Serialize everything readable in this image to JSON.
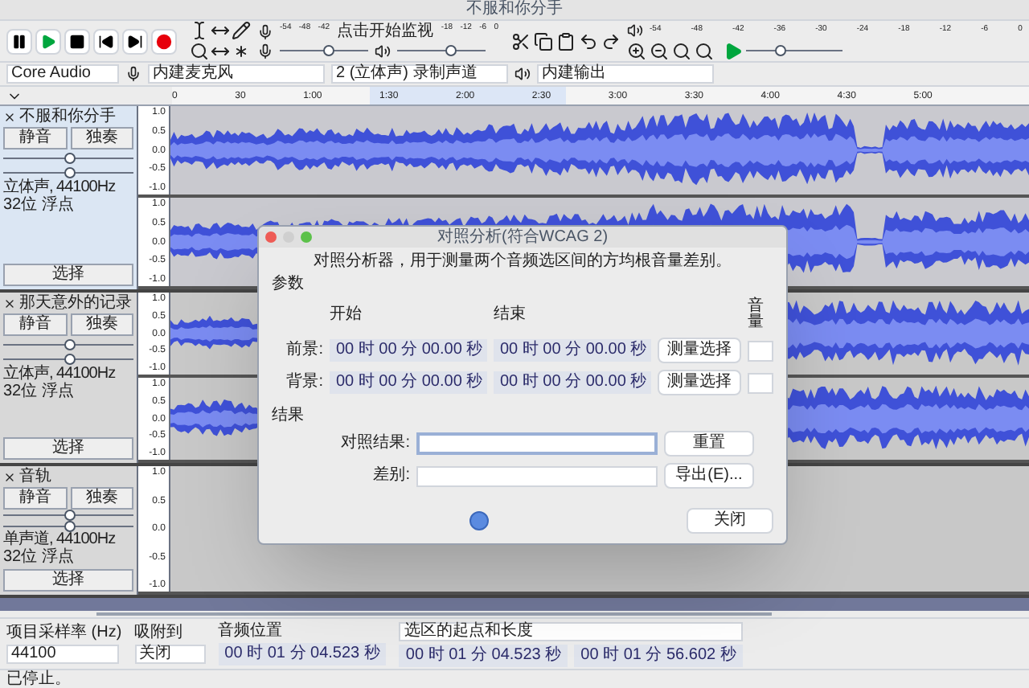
{
  "window": {
    "title": "不服和你分手"
  },
  "record_meter": {
    "ticks": [
      "-54",
      "-48",
      "-42",
      "点击开始监视",
      "-18",
      "-12",
      "-6",
      "0"
    ]
  },
  "playback_meter": {
    "ticks": [
      "-54",
      "-48",
      "-42",
      "-36",
      "-30",
      "-24",
      "-18",
      "-12",
      "-6",
      "0"
    ]
  },
  "record_volume": {
    "level": 0.55
  },
  "playback_volume": {
    "level": 0.6
  },
  "play_speed": {
    "level": 0.35
  },
  "devices": {
    "host": "Core Audio",
    "input": "内建麦克风",
    "channels": "2 (立体声) 录制声道",
    "output": "内建输出"
  },
  "ruler": {
    "ticks": [
      "0",
      "30",
      "1:00",
      "1:30",
      "2:00",
      "2:30",
      "3:00",
      "3:30",
      "4:00",
      "4:30",
      "5:00"
    ]
  },
  "tracks": [
    {
      "name": "不服和你分手",
      "selected": true,
      "mute": "静音",
      "solo": "独奏",
      "gain": {
        "level": 0.5
      },
      "pan": {
        "level": 0.5
      },
      "info": "立体声, 44100Hz",
      "format": "32位 浮点",
      "select": "选择",
      "channels": [
        {
          "has_audio": true,
          "scale": [
            "1.0",
            "0.5",
            "0.0",
            "-0.5",
            "-1.0"
          ]
        },
        {
          "has_audio": true,
          "scale": [
            "1.0",
            "0.5",
            "0.0",
            "-0.5",
            "-1.0"
          ]
        }
      ]
    },
    {
      "name": "那天意外的记录",
      "selected": false,
      "mute": "静音",
      "solo": "独奏",
      "gain": {
        "level": 0.5
      },
      "pan": {
        "level": 0.5
      },
      "info": "立体声, 44100Hz",
      "format": "32位 浮点",
      "select": "选择",
      "channels": [
        {
          "has_audio": true,
          "scale": [
            "1.0",
            "0.5",
            "0.0",
            "-0.5",
            "-1.0"
          ]
        },
        {
          "has_audio": true,
          "scale": [
            "1.0",
            "0.5",
            "0.0",
            "-0.5",
            "-1.0"
          ]
        }
      ]
    },
    {
      "name": "音轨",
      "selected": false,
      "mute": "静音",
      "solo": "独奏",
      "gain": {
        "level": 0.5
      },
      "pan": {
        "level": 0.5
      },
      "info": "单声道, 44100Hz",
      "format": "32位 浮点",
      "select": "选择",
      "channels": [
        {
          "has_audio": false,
          "scale": [
            "1.0",
            "0.5",
            "0.0",
            "-0.5",
            "-1.0"
          ]
        }
      ]
    }
  ],
  "dialog": {
    "title": "对照分析(符合WCAG 2)",
    "description": "对照分析器，用于测量两个音频选区间的方均根音量差别。",
    "params_label": "参数",
    "col_start": "开始",
    "col_end": "结束",
    "col_volume": "音量",
    "rows": [
      {
        "label": "前景:",
        "start": "00 时 00 分 00.00 秒",
        "end": "00 时 00 分 00.00 秒",
        "button": "测量选择"
      },
      {
        "label": "背景:",
        "start": "00 时 00 分 00.00 秒",
        "end": "00 时 00 分 00.00 秒",
        "button": "测量选择"
      }
    ],
    "results_label": "结果",
    "contrast_label": "对照结果:",
    "reset": "重置",
    "diff_label": "差别:",
    "export": "导出(E)...",
    "close": "关闭"
  },
  "selection_bar": {
    "rate_label": "项目采样率 (Hz)",
    "snap_label": "吸附到",
    "position_label": "音频位置",
    "selection_label": "选区的起点和长度",
    "rate": "44100",
    "snap": "关闭",
    "position": "00 时 01 分 04.523 秒",
    "sel_start": "00 时 01 分 04.523 秒",
    "sel_length": "00 时 01 分 56.602 秒"
  },
  "status_bar": {
    "text": "已停止。"
  }
}
